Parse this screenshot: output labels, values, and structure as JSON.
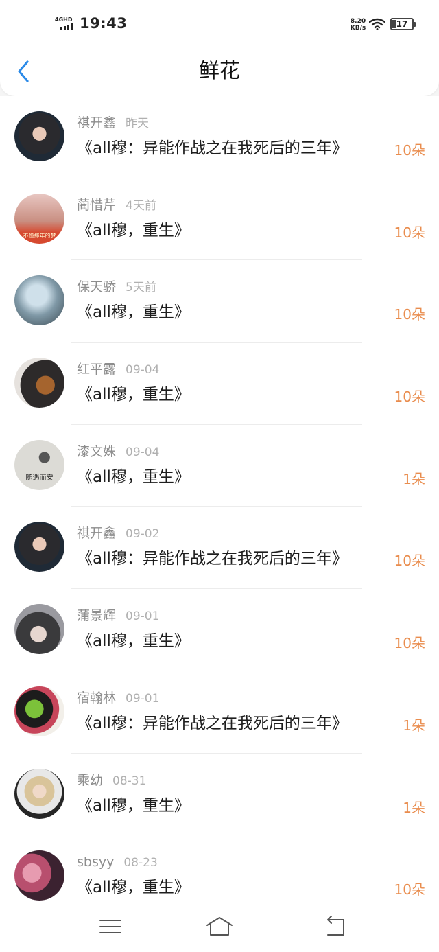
{
  "status_bar": {
    "network": "4GHD",
    "time": "19:43",
    "speed_value": "8.20",
    "speed_unit": "KB/s",
    "battery": "17"
  },
  "header": {
    "title": "鲜花"
  },
  "items": [
    {
      "name": "祺开鑫",
      "time": "昨天",
      "book": "《all穆：异能作战之在我死后的三年》",
      "count": "10朵"
    },
    {
      "name": "蔺惜芹",
      "time": "4天前",
      "book": "《all穆，重生》",
      "count": "10朵",
      "avatar_caption": "不懂那年的梦"
    },
    {
      "name": "保天骄",
      "time": "5天前",
      "book": "《all穆，重生》",
      "count": "10朵"
    },
    {
      "name": "红平露",
      "time": "09-04",
      "book": "《all穆，重生》",
      "count": "10朵"
    },
    {
      "name": "漆文姝",
      "time": "09-04",
      "book": "《all穆，重生》",
      "count": "1朵",
      "avatar_caption": "随遇而安"
    },
    {
      "name": "祺开鑫",
      "time": "09-02",
      "book": "《all穆：异能作战之在我死后的三年》",
      "count": "10朵"
    },
    {
      "name": "蒲景辉",
      "time": "09-01",
      "book": "《all穆，重生》",
      "count": "10朵"
    },
    {
      "name": "宿翰林",
      "time": "09-01",
      "book": "《all穆：异能作战之在我死后的三年》",
      "count": "1朵"
    },
    {
      "name": "乘幼",
      "time": "08-31",
      "book": "《all穆，重生》",
      "count": "1朵"
    },
    {
      "name": "sbsyy",
      "time": "08-23",
      "book": "《all穆，重生》",
      "count": "10朵"
    }
  ],
  "icons": {
    "back": "chevron-left-icon",
    "menu": "menu-icon",
    "home": "home-icon",
    "return": "return-icon"
  },
  "colors": {
    "accent": "#2b8ae8",
    "count": "#e98c4d"
  }
}
